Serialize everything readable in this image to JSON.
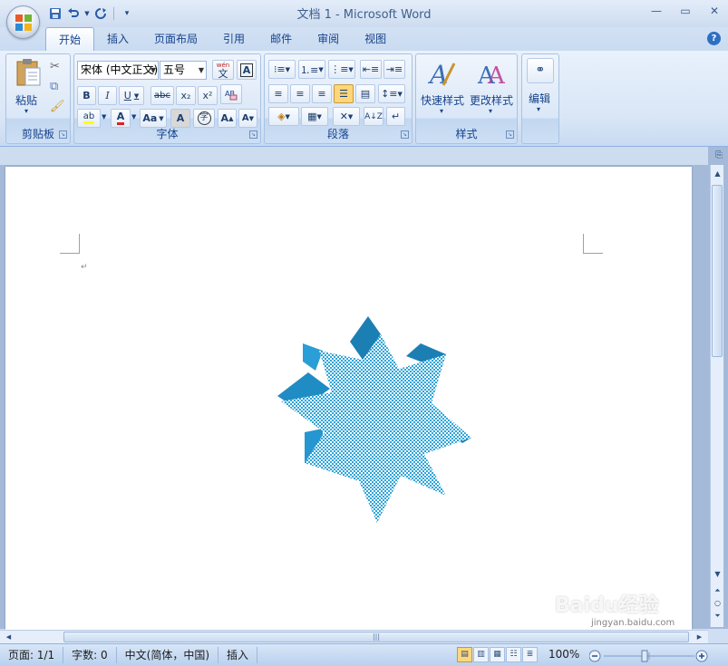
{
  "window": {
    "title": "文档 1 - Microsoft Word"
  },
  "quick_access": {
    "save_icon": "save-icon",
    "undo_icon": "undo-icon",
    "redo_icon": "redo-icon",
    "customize_icon": "customize-icon"
  },
  "tabs": [
    {
      "label": "开始",
      "active": true
    },
    {
      "label": "插入"
    },
    {
      "label": "页面布局"
    },
    {
      "label": "引用"
    },
    {
      "label": "邮件"
    },
    {
      "label": "审阅"
    },
    {
      "label": "视图"
    }
  ],
  "ribbon": {
    "clipboard": {
      "label": "剪贴板",
      "paste_label": "粘贴"
    },
    "font": {
      "label": "字体",
      "font_name": "宋体 (中文正文)",
      "font_size": "五号",
      "phonetic_label": "wén",
      "bold": "B",
      "italic": "I",
      "underline": "U",
      "strike": "abc",
      "subscript": "x₂",
      "superscript": "x²",
      "change_case": "Aa",
      "highlight": "ab",
      "font_color": "A",
      "grow": "A",
      "shrink": "A"
    },
    "paragraph": {
      "label": "段落"
    },
    "styles": {
      "label": "样式",
      "quick_styles": "快速样式",
      "change_styles": "更改样式"
    },
    "editing": {
      "label": "编辑"
    }
  },
  "document": {
    "paragraph_mark": "↵",
    "shape": {
      "type": "8-point star",
      "fill_color": "#4fb7e0",
      "side_color": "#1e8fc4"
    }
  },
  "scrollbar": {
    "h_thumb_mark": "|||"
  },
  "statusbar": {
    "page": "页面: 1/1",
    "words": "字数: 0",
    "language": "中文(简体，中国)",
    "mode": "插入",
    "zoom": "100%"
  },
  "colors": {
    "accent": "#15428b",
    "ribbon_bg": "#d9e6f6",
    "highlight": "#ffd77a"
  },
  "watermark": {
    "text": "Baidu经验",
    "sub": "jingyan.baidu.com"
  }
}
